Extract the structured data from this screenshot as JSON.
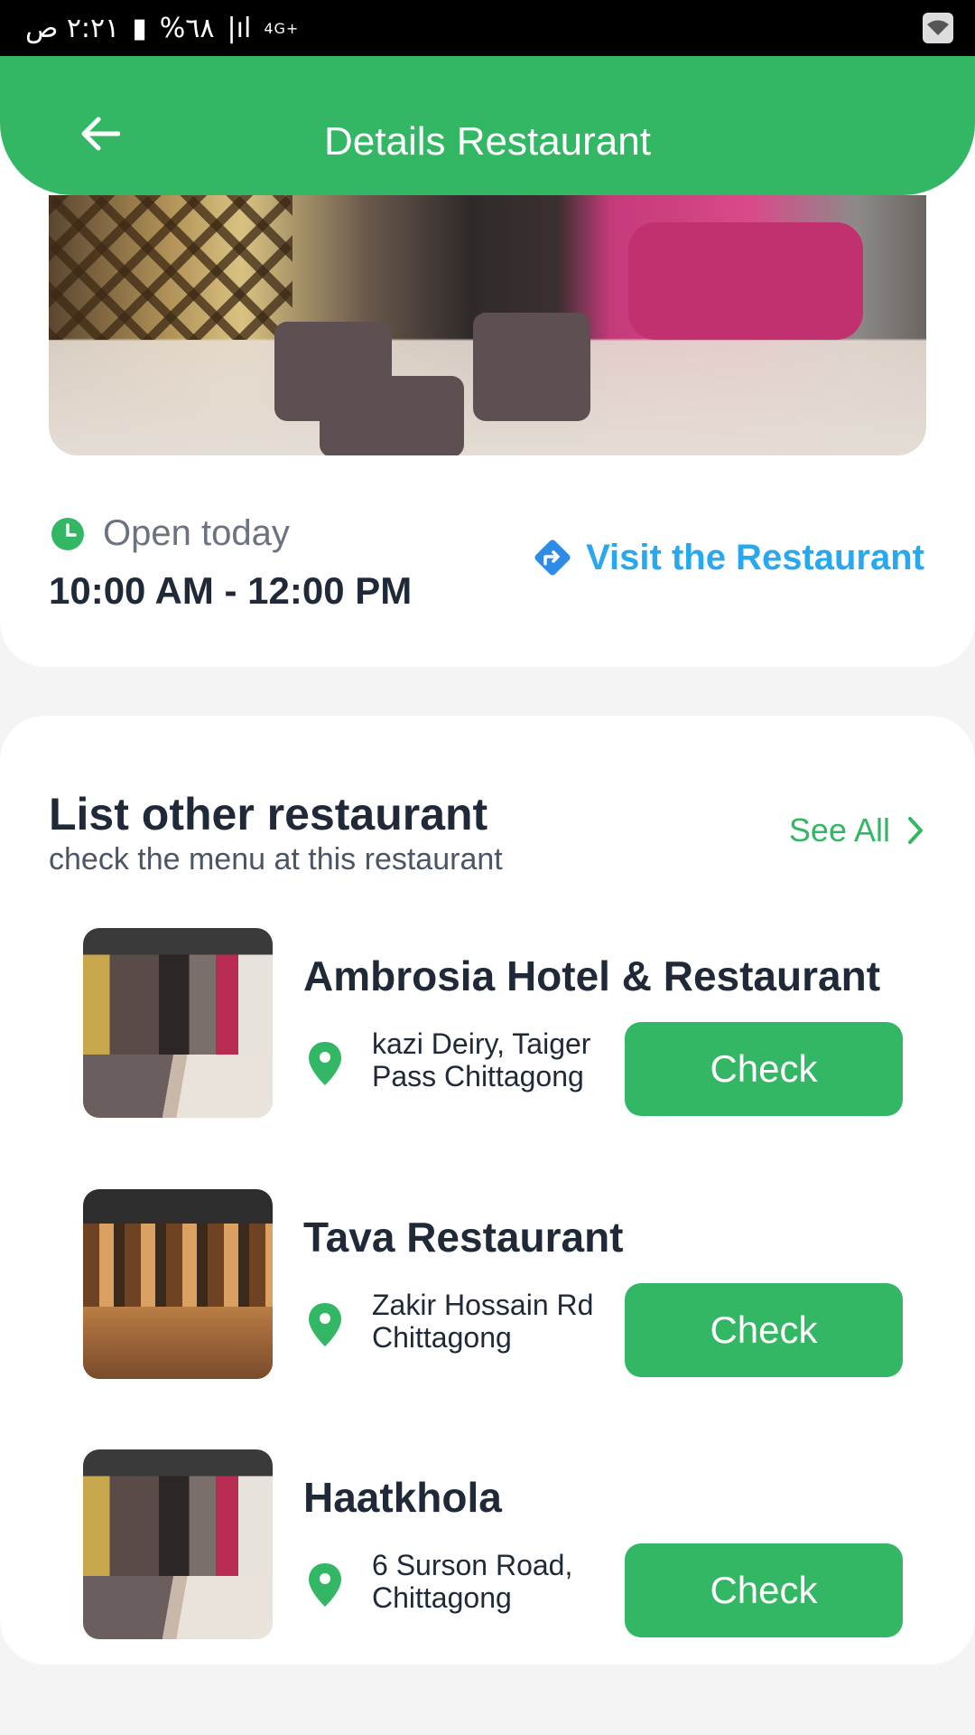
{
  "status_bar": {
    "time": "٢:٢١ ص",
    "battery": "%٦٨",
    "network": "4G+"
  },
  "header": {
    "title": "Details Restaurant"
  },
  "restaurant": {
    "open_label": "Open today",
    "hours": "10:00 AM - 12:00 PM",
    "visit_label": "Visit the Restaurant"
  },
  "other": {
    "title": "List other restaurant",
    "subtitle": "check the menu at this restaurant",
    "see_all": "See All",
    "items": [
      {
        "name": "Ambrosia Hotel & Restaurant",
        "address": "kazi Deiry, Taiger Pass Chittagong",
        "button": "Check"
      },
      {
        "name": "Tava Restaurant",
        "address": "Zakir Hossain Rd Chittagong",
        "button": "Check"
      },
      {
        "name": "Haatkhola",
        "address": "6 Surson Road, Chittagong",
        "button": "Check"
      }
    ]
  },
  "colors": {
    "primary_green": "#34b765",
    "link_blue": "#29a8ef",
    "text_dark": "#1f2937"
  }
}
